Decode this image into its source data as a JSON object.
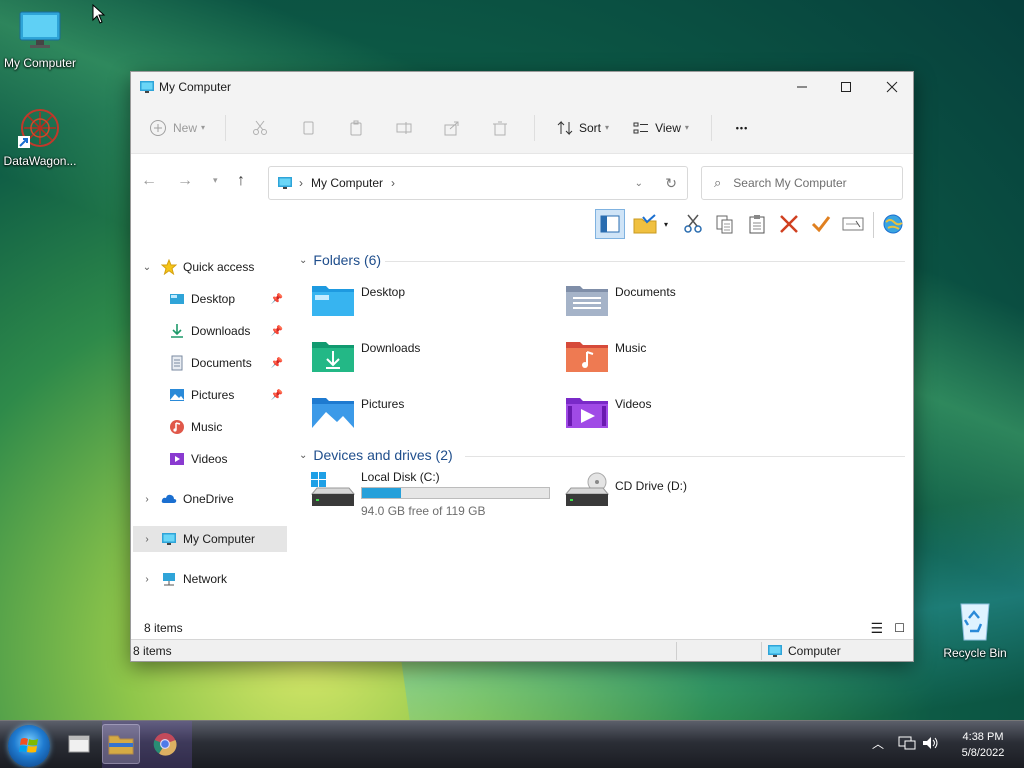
{
  "desktop": {
    "icons": [
      {
        "label": "My Computer"
      },
      {
        "label": "DataWagon..."
      },
      {
        "label": "Recycle Bin"
      }
    ]
  },
  "window": {
    "title": "My Computer",
    "controls": {
      "minimize": "—",
      "maximize": "☐",
      "close": "✕"
    }
  },
  "commandbar": {
    "new_label": "New",
    "sort_label": "Sort",
    "view_label": "View",
    "more_label": "•••"
  },
  "address": {
    "path_item": "My Computer",
    "search_placeholder": "Search My Computer"
  },
  "nav": {
    "quick_access": "Quick access",
    "items": [
      {
        "label": "Desktop"
      },
      {
        "label": "Downloads"
      },
      {
        "label": "Documents"
      },
      {
        "label": "Pictures"
      },
      {
        "label": "Music"
      },
      {
        "label": "Videos"
      }
    ],
    "onedrive": "OneDrive",
    "my_computer": "My Computer",
    "network": "Network"
  },
  "folders": {
    "header": "Folders (6)",
    "items": [
      {
        "label": "Desktop"
      },
      {
        "label": "Documents"
      },
      {
        "label": "Downloads"
      },
      {
        "label": "Music"
      },
      {
        "label": "Pictures"
      },
      {
        "label": "Videos"
      }
    ]
  },
  "drives": {
    "header": "Devices and drives (2)",
    "items": [
      {
        "label": "Local Disk (C:)",
        "free_text": "94.0 GB free of 119 GB",
        "used_fraction": 0.21
      },
      {
        "label": "CD Drive (D:)"
      }
    ]
  },
  "status": {
    "items_count": "8 items",
    "bottom_items": "8 items",
    "location": "Computer"
  },
  "taskbar": {
    "time": "4:38 PM",
    "date": "5/8/2022"
  },
  "colors": {
    "accent": "#1f7bd0",
    "group_header": "#1f4e8c",
    "drive_bar": "#26a0da"
  }
}
